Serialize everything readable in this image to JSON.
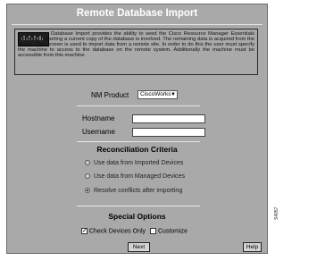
{
  "window": {
    "title": "Remote Database Import"
  },
  "description": {
    "text": "Database Import provides the ability to seed the Cisco Resource Manager Essentials inventory, importing a current copy of the database is involved. The remaining data is acquired from the device. This screen is used to import data from a remote site. In order to do this the user must specify the machine to access to the database on the remote system. Additionally the machine must be accessible from this machine."
  },
  "form": {
    "nm_product_label": "NM Product",
    "nm_product_value": "CiscoWorks",
    "hostname_label": "Hostname",
    "hostname_value": "",
    "username_label": "Username",
    "username_value": ""
  },
  "reconciliation": {
    "title": "Reconciliation Criteria",
    "options": [
      {
        "label": "Use data from Imported Devices",
        "selected": false
      },
      {
        "label": "Use data from Managed Devices",
        "selected": false
      },
      {
        "label": "Resolve conflicts after importing",
        "selected": true
      }
    ]
  },
  "special": {
    "title": "Special Options",
    "check_devices_label": "Check Devices Only",
    "check_devices_checked": true,
    "customize_label": "Customize",
    "customize_checked": false
  },
  "buttons": {
    "next": "Next",
    "help": "Help"
  },
  "side_id": "S4057"
}
